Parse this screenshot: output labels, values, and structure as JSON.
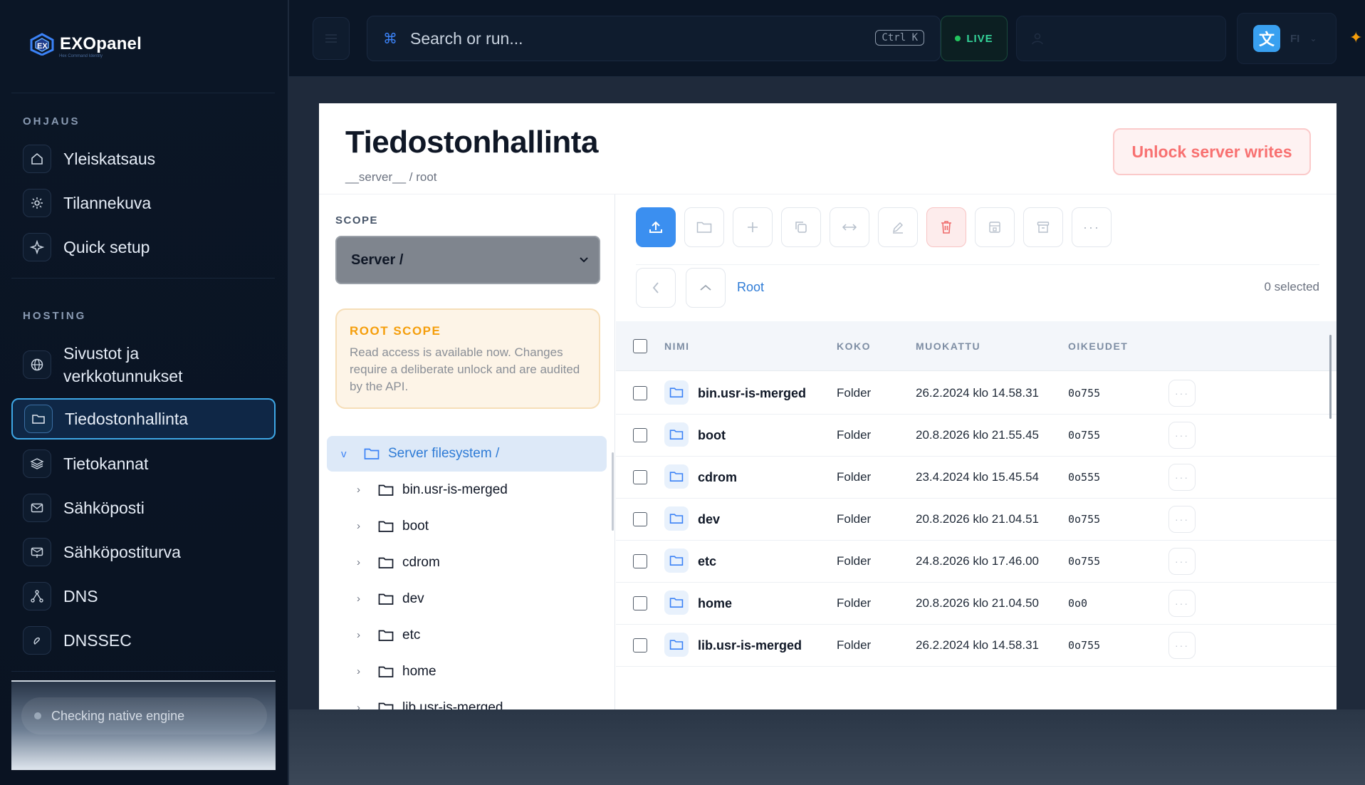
{
  "brand": {
    "name": "EXOpanel",
    "tagline": "Hex Command Identity"
  },
  "sidebar": {
    "sections": [
      {
        "title": "OHJAUS",
        "items": [
          {
            "label": "Yleiskatsaus",
            "icon": "home-icon"
          },
          {
            "label": "Tilannekuva",
            "icon": "sun-icon"
          },
          {
            "label": "Quick setup",
            "icon": "sparkle-icon"
          }
        ]
      },
      {
        "title": "HOSTING",
        "items": [
          {
            "label": "Sivustot ja verkkotunnukset",
            "icon": "globe-icon"
          },
          {
            "label": "Tiedostonhallinta",
            "icon": "folder-icon",
            "active": true
          },
          {
            "label": "Tietokannat",
            "icon": "layers-icon"
          },
          {
            "label": "Sähköposti",
            "icon": "mail-icon"
          },
          {
            "label": "Sähköpostiturva",
            "icon": "mail-shield-icon"
          },
          {
            "label": "DNS",
            "icon": "network-icon"
          },
          {
            "label": "DNSSEC",
            "icon": "key-icon"
          }
        ]
      }
    ],
    "engine_status": "Checking native engine"
  },
  "topbar": {
    "search_placeholder": "Search or run...",
    "shortcut": "Ctrl K",
    "live_label": "LIVE",
    "language_badge": "文",
    "language_code": "FI"
  },
  "page": {
    "title": "Tiedostonhallinta",
    "breadcrumb": "__server__ / root",
    "unlock_button": "Unlock server writes"
  },
  "scope": {
    "label": "SCOPE",
    "selected": "Server /",
    "notice_title": "ROOT SCOPE",
    "notice_text": "Read access is available now. Changes require a deliberate unlock and are audited by the API."
  },
  "tree": {
    "root": "Server filesystem /",
    "items": [
      "bin.usr-is-merged",
      "boot",
      "cdrom",
      "dev",
      "etc",
      "home",
      "lib.usr-is-merged"
    ]
  },
  "toolbar": {
    "buttons": [
      "upload-icon",
      "folder-icon",
      "plus-icon",
      "copy-icon",
      "move-icon",
      "rename-icon",
      "trash-icon",
      "archive-icon",
      "extract-icon",
      "more-icon"
    ]
  },
  "navigation": {
    "current": "Root",
    "selected_count": "0 selected"
  },
  "table": {
    "columns": {
      "name": "NIMI",
      "size": "KOKO",
      "modified": "MUOKATTU",
      "permissions": "OIKEUDET"
    },
    "rows": [
      {
        "name": "bin.usr-is-merged",
        "size": "Folder",
        "modified": "26.2.2024 klo 14.58.31",
        "perm": "0o755"
      },
      {
        "name": "boot",
        "size": "Folder",
        "modified": "20.8.2026 klo 21.55.45",
        "perm": "0o755"
      },
      {
        "name": "cdrom",
        "size": "Folder",
        "modified": "23.4.2024 klo 15.45.54",
        "perm": "0o555"
      },
      {
        "name": "dev",
        "size": "Folder",
        "modified": "20.8.2026 klo 21.04.51",
        "perm": "0o755"
      },
      {
        "name": "etc",
        "size": "Folder",
        "modified": "24.8.2026 klo 17.46.00",
        "perm": "0o755"
      },
      {
        "name": "home",
        "size": "Folder",
        "modified": "20.8.2026 klo 21.04.50",
        "perm": "0o0"
      },
      {
        "name": "lib.usr-is-merged",
        "size": "Folder",
        "modified": "26.2.2024 klo 14.58.31",
        "perm": "0o755"
      }
    ],
    "row_action": "···"
  }
}
